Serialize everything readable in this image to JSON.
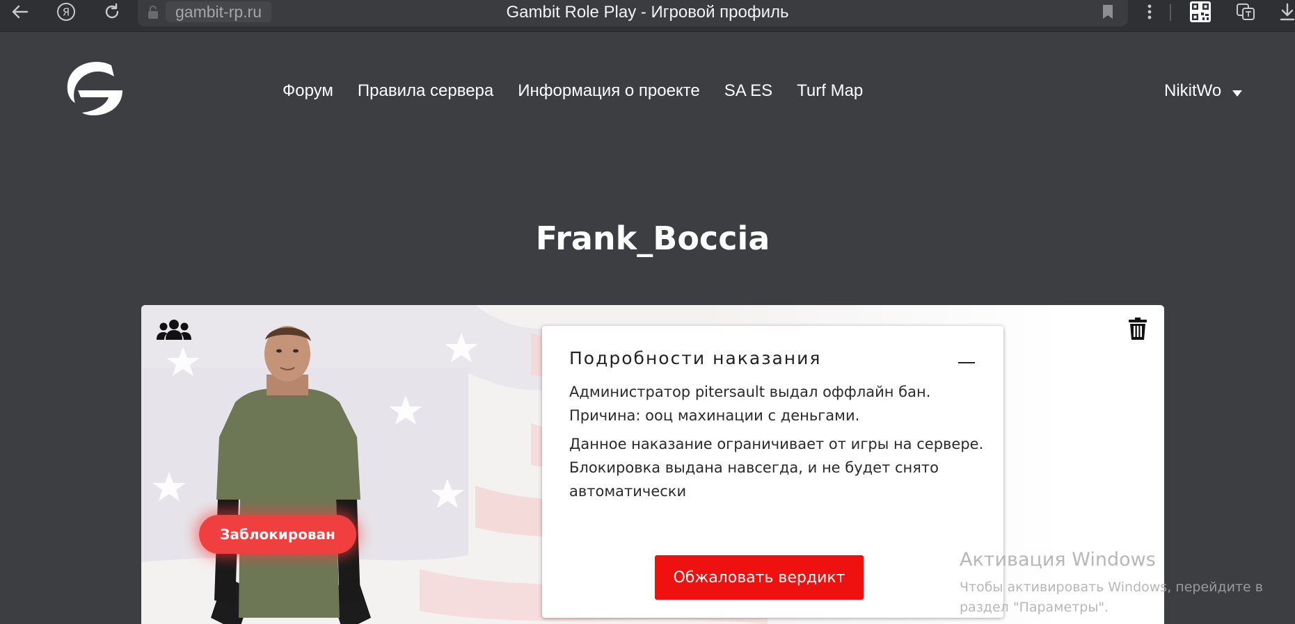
{
  "browser": {
    "domain": "gambit-rp.ru",
    "tab_title": "Gambit Role Play - Игровой профиль"
  },
  "site": {
    "nav": [
      "Форум",
      "Правила сервера",
      "Информация о проекте",
      "SA ES",
      "Turf Map"
    ],
    "user": "NikitWo"
  },
  "profile": {
    "name": "Frank_Boccia",
    "status_badge": "Заблокирован",
    "punishment": {
      "title": "Подробности наказания",
      "line1": "Администратор pitersault выдал оффлайн бан.",
      "line2": "Причина: ooц махинации с деньгами.",
      "line3": "Данное наказание ограничивает от игры на сервере. Блокировка выдана навсегда, и не будет снято автоматически",
      "appeal_button": "Обжаловать вердикт"
    }
  },
  "windows_watermark": {
    "title": "Активация Windows",
    "subtitle": "Чтобы активировать Windows, перейдите в раздел \"Параметры\"."
  },
  "colors": {
    "page_bg": "#3d3e41",
    "accent_red": "#ef1010",
    "badge_red": "#f03f3f"
  }
}
